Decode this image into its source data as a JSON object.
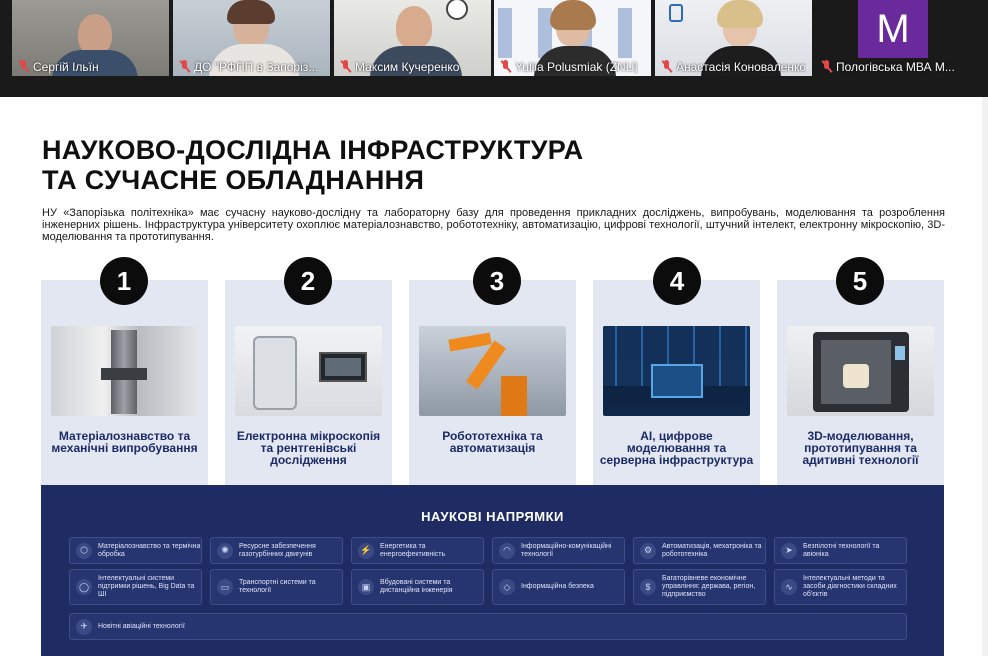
{
  "participants": [
    {
      "name": "Сергій Ільїн",
      "mic": "muted"
    },
    {
      "name": "ДО \"РФПП в Запоріз...",
      "mic": "muted"
    },
    {
      "name": "Максим Кучеренко",
      "mic": "muted"
    },
    {
      "name": "Yuliia Polusmiak (ZNU)",
      "mic": "muted"
    },
    {
      "name": "Анастасія Коноваленко",
      "mic": "muted"
    },
    {
      "name": "Пологівська МВА М...",
      "mic": "muted",
      "avatar_letter": "M"
    }
  ],
  "slide": {
    "title_line1": "НАУКОВО-ДОСЛІДНА ІНФРАСТРУКТУРА",
    "title_line2": "ТА СУЧАСНЕ ОБЛАДНАННЯ",
    "intro": "НУ «Запорізька політехніка» має сучасну науково-дослідну та лабораторну базу для проведення прикладних досліджень, випробувань, моделювання та розроблення інженерних рішень. Інфраструктура університету охоплює матеріалознавство, робототехніку, автоматизацію, цифрові технології, штучний інтелект, електронну мікроскопію, 3D-моделювання та прототипування.",
    "cards": [
      {
        "number": "1",
        "label": "Матеріалознавство та механічні випробування"
      },
      {
        "number": "2",
        "label": "Електронна мікроскопія та рентгенівські дослідження"
      },
      {
        "number": "3",
        "label": "Робототехніка та автоматизація"
      },
      {
        "number": "4",
        "label": "AI, цифрове моделювання та серверна інфраструктура"
      },
      {
        "number": "5",
        "label": "3D-моделювання, прототипування та адитивні технології"
      }
    ],
    "directions_title": "НАУКОВІ НАПРЯМКИ",
    "directions": [
      {
        "icon": "cube-icon",
        "glyph": "⬡",
        "label": "Матеріалознавство та термічна обробка"
      },
      {
        "icon": "sun-icon",
        "glyph": "✺",
        "label": "Ресурсне забезпечення газотурбінних двигунів"
      },
      {
        "icon": "bolt-icon",
        "glyph": "⚡",
        "label": "Енергетика та енергоефективність"
      },
      {
        "icon": "wifi-icon",
        "glyph": "◠",
        "label": "Інформаційно-комунікаційні технології"
      },
      {
        "icon": "robot-icon",
        "glyph": "⚙",
        "label": "Автоматизація, мехатроніка та робототехніка"
      },
      {
        "icon": "plane-icon",
        "glyph": "➤",
        "label": "Безпілотні технології та авіоніка"
      },
      {
        "icon": "chat-icon",
        "glyph": "◯",
        "label": "Інтелектуальні системи підтримки рішень, Big Data та ШІ"
      },
      {
        "icon": "truck-icon",
        "glyph": "▭",
        "label": "Транспортні системи та технології"
      },
      {
        "icon": "chip-icon",
        "glyph": "▣",
        "label": "Вбудовані системи та дистанційна інженерія"
      },
      {
        "icon": "shield-icon",
        "glyph": "◇",
        "label": "Інформаційна безпека"
      },
      {
        "icon": "dollar-icon",
        "glyph": "$",
        "label": "Багаторівневе економічне управління: держава, регіон, підприємство"
      },
      {
        "icon": "pulse-icon",
        "glyph": "∿",
        "label": "Інтелектуальні методи та засоби діагностики складних об'єктів"
      },
      {
        "icon": "aircraft-icon",
        "glyph": "✈",
        "label": "Новітні авіаційні технології"
      }
    ]
  }
}
